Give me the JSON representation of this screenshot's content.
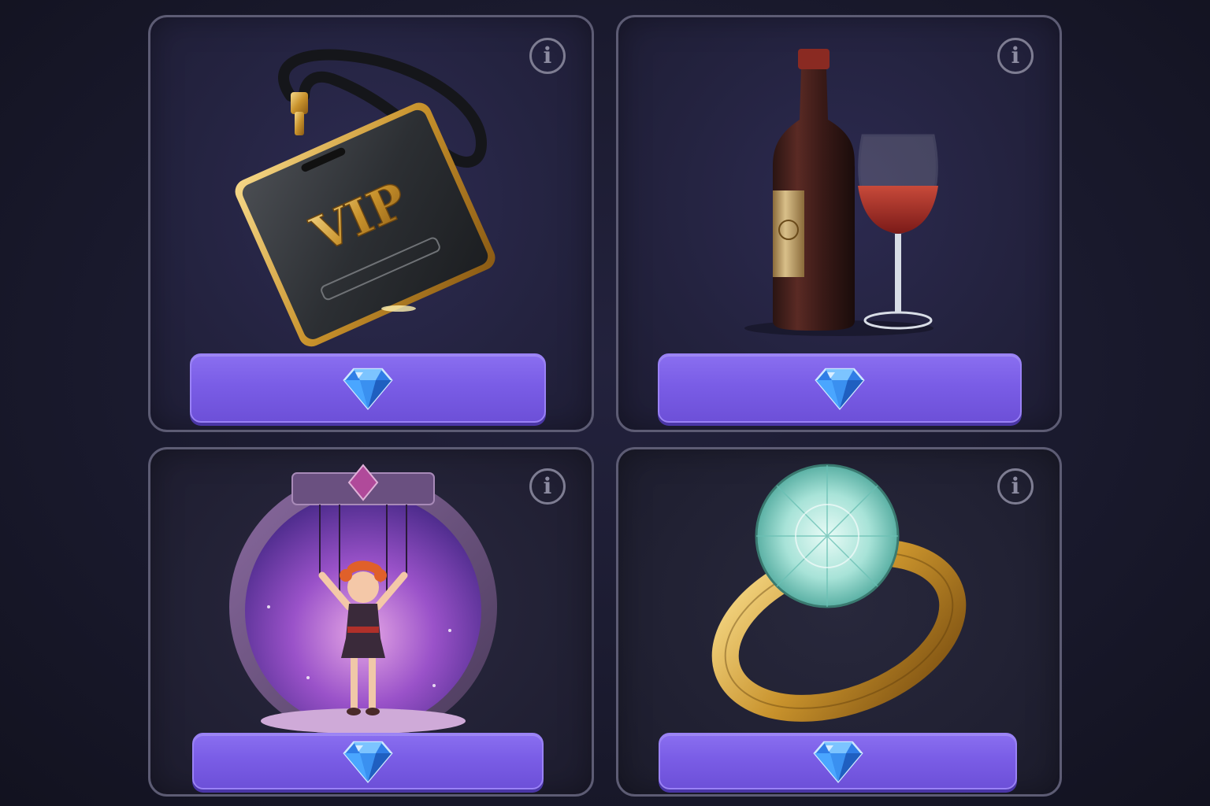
{
  "shop": {
    "items": [
      {
        "id": "vip-pass",
        "art": "vip-badge-lanyard",
        "badge_text": "VIP",
        "info_icon": "i",
        "price_icon": "diamond-gem-icon"
      },
      {
        "id": "wine",
        "art": "wine-bottle-and-glass",
        "info_icon": "i",
        "price_icon": "diamond-gem-icon"
      },
      {
        "id": "puppet-stage",
        "art": "marionette-on-stage",
        "info_icon": "i",
        "price_icon": "diamond-gem-icon"
      },
      {
        "id": "diamond-ring",
        "art": "gold-ring-with-gem",
        "info_icon": "i",
        "price_icon": "diamond-gem-icon"
      }
    ]
  },
  "colors": {
    "background": "#1a1a2e",
    "card_border": "#5d5c74",
    "button": "#7a5de6",
    "gem": "#4aa6ff",
    "gold": "#d9a93a"
  }
}
